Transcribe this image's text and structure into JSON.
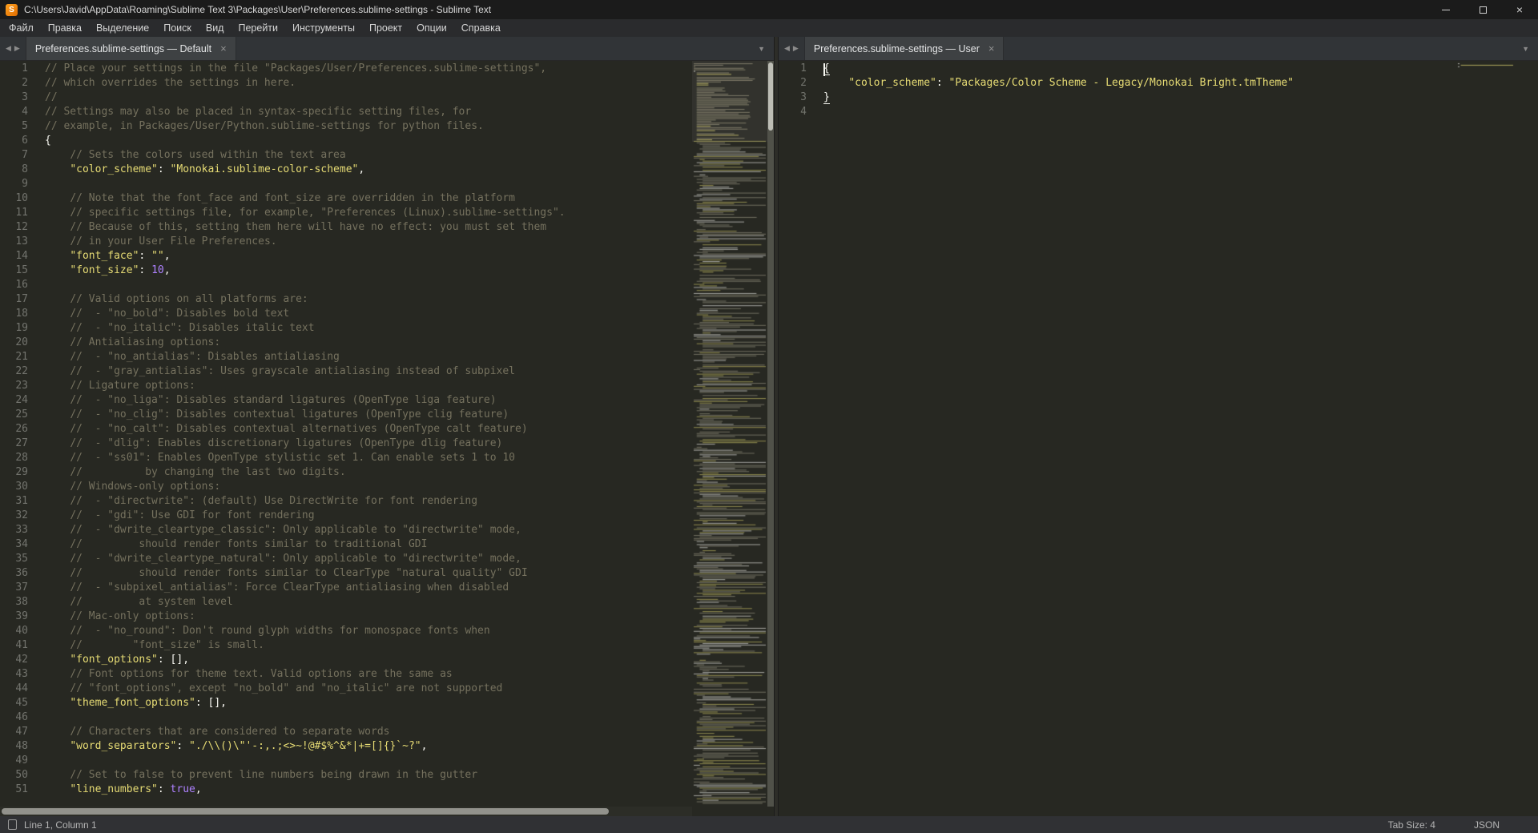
{
  "window": {
    "title": "C:\\Users\\Javid\\AppData\\Roaming\\Sublime Text 3\\Packages\\User\\Preferences.sublime-settings - Sublime Text",
    "app_icon": "S",
    "controls": {
      "minimize": "—",
      "maximize": "▢",
      "close": "×"
    }
  },
  "menu": {
    "items": [
      "Файл",
      "Правка",
      "Выделение",
      "Поиск",
      "Вид",
      "Перейти",
      "Инструменты",
      "Проект",
      "Опции",
      "Справка"
    ]
  },
  "panes": [
    {
      "tab": {
        "title": "Preferences.sublime-settings — Default",
        "close_icon": "×"
      },
      "nav": {
        "prev_icon": "◀",
        "next_icon": "▶",
        "overflow_icon": "▼"
      },
      "lines": [
        "// Place your settings in the file \"Packages/User/Preferences.sublime-settings\",",
        "// which overrides the settings in here.",
        "//",
        "// Settings may also be placed in syntax-specific setting files, for",
        "// example, in Packages/User/Python.sublime-settings for python files.",
        "{",
        "\t// Sets the colors used within the text area",
        "\t\"color_scheme\": \"Monokai.sublime-color-scheme\",",
        "",
        "\t// Note that the font_face and font_size are overridden in the platform",
        "\t// specific settings file, for example, \"Preferences (Linux).sublime-settings\".",
        "\t// Because of this, setting them here will have no effect: you must set them",
        "\t// in your User File Preferences.",
        "\t\"font_face\": \"\",",
        "\t\"font_size\": 10,",
        "",
        "\t// Valid options on all platforms are:",
        "\t//  - \"no_bold\": Disables bold text",
        "\t//  - \"no_italic\": Disables italic text",
        "\t// Antialiasing options:",
        "\t//  - \"no_antialias\": Disables antialiasing",
        "\t//  - \"gray_antialias\": Uses grayscale antialiasing instead of subpixel",
        "\t// Ligature options:",
        "\t//  - \"no_liga\": Disables standard ligatures (OpenType liga feature)",
        "\t//  - \"no_clig\": Disables contextual ligatures (OpenType clig feature)",
        "\t//  - \"no_calt\": Disables contextual alternatives (OpenType calt feature)",
        "\t//  - \"dlig\": Enables discretionary ligatures (OpenType dlig feature)",
        "\t//  - \"ss01\": Enables OpenType stylistic set 1. Can enable sets 1 to 10",
        "\t//          by changing the last two digits.",
        "\t// Windows-only options:",
        "\t//  - \"directwrite\": (default) Use DirectWrite for font rendering",
        "\t//  - \"gdi\": Use GDI for font rendering",
        "\t//  - \"dwrite_cleartype_classic\": Only applicable to \"directwrite\" mode,",
        "\t//         should render fonts similar to traditional GDI",
        "\t//  - \"dwrite_cleartype_natural\": Only applicable to \"directwrite\" mode,",
        "\t//         should render fonts similar to ClearType \"natural quality\" GDI",
        "\t//  - \"subpixel_antialias\": Force ClearType antialiasing when disabled",
        "\t//         at system level",
        "\t// Mac-only options:",
        "\t//  - \"no_round\": Don't round glyph widths for monospace fonts when",
        "\t//        \"font_size\" is small.",
        "\t\"font_options\": [],",
        "\t// Font options for theme text. Valid options are the same as",
        "\t// \"font_options\", except \"no_bold\" and \"no_italic\" are not supported",
        "\t\"theme_font_options\": [],",
        "",
        "\t// Characters that are considered to separate words",
        "\t\"word_separators\": \"./\\\\()\\\"'-:,.;<>~!@#$%^&*|+=[]{}`~?\",",
        "",
        "\t// Set to false to prevent line numbers being drawn in the gutter",
        "\t\"line_numbers\": true,"
      ]
    },
    {
      "tab": {
        "title": "Preferences.sublime-settings — User",
        "close_icon": "×"
      },
      "nav": {
        "prev_icon": "◀",
        "next_icon": "▶",
        "overflow_icon": "▼"
      },
      "lines": [
        "{",
        "\t\"color_scheme\": \"Packages/Color Scheme - Legacy/Monokai Bright.tmTheme\"",
        "}",
        ""
      ],
      "caret": {
        "line": 1,
        "column": 1
      }
    }
  ],
  "status": {
    "position": "Line 1, Column 1",
    "tab_size": "Tab Size: 4",
    "syntax": "JSON"
  },
  "colors": {
    "editor_bg": "#272822",
    "comment": "#75715E",
    "string": "#E6DB74",
    "constant": "#AE81FF",
    "foreground": "#F8F8F2",
    "gutter": "#8F908A"
  }
}
